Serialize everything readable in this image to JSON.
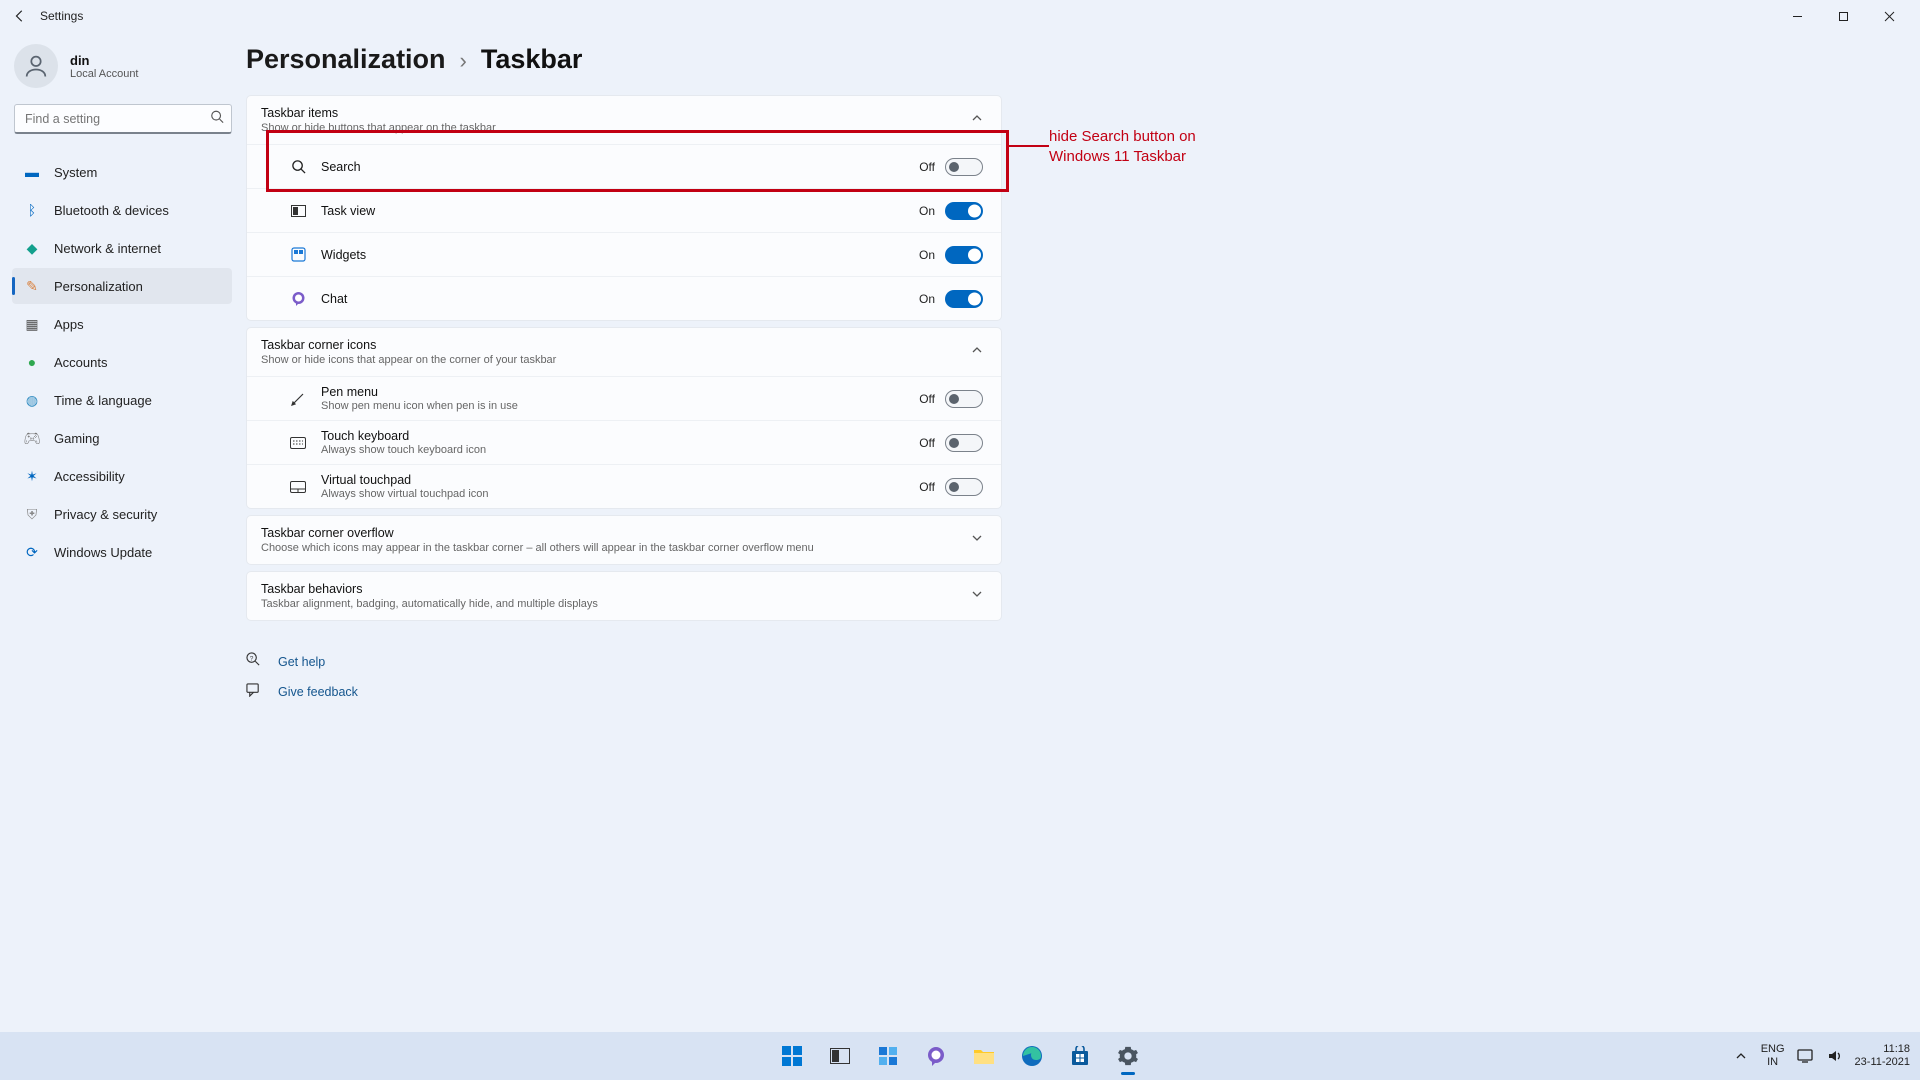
{
  "titlebar": {
    "title": "Settings"
  },
  "user": {
    "name": "din",
    "account": "Local Account"
  },
  "search": {
    "placeholder": "Find a setting"
  },
  "nav": {
    "system": "System",
    "bluetooth": "Bluetooth & devices",
    "network": "Network & internet",
    "personalization": "Personalization",
    "apps": "Apps",
    "accounts": "Accounts",
    "time": "Time & language",
    "gaming": "Gaming",
    "accessibility": "Accessibility",
    "privacy": "Privacy & security",
    "update": "Windows Update"
  },
  "crumb": {
    "parent": "Personalization",
    "sep": "›",
    "current": "Taskbar"
  },
  "panels": {
    "items": {
      "title": "Taskbar items",
      "sub": "Show or hide buttons that appear on the taskbar",
      "search": {
        "label": "Search",
        "state": "Off"
      },
      "taskview": {
        "label": "Task view",
        "state": "On"
      },
      "widgets": {
        "label": "Widgets",
        "state": "On"
      },
      "chat": {
        "label": "Chat",
        "state": "On"
      }
    },
    "corner": {
      "title": "Taskbar corner icons",
      "sub": "Show or hide icons that appear on the corner of your taskbar",
      "pen": {
        "label": "Pen menu",
        "sub": "Show pen menu icon when pen is in use",
        "state": "Off"
      },
      "touchkb": {
        "label": "Touch keyboard",
        "sub": "Always show touch keyboard icon",
        "state": "Off"
      },
      "touchpad": {
        "label": "Virtual touchpad",
        "sub": "Always show virtual touchpad icon",
        "state": "Off"
      }
    },
    "overflow": {
      "title": "Taskbar corner overflow",
      "sub": "Choose which icons may appear in the taskbar corner – all others will appear in the taskbar corner overflow menu"
    },
    "behaviors": {
      "title": "Taskbar behaviors",
      "sub": "Taskbar alignment, badging, automatically hide, and multiple displays"
    }
  },
  "links": {
    "help": "Get help",
    "feedback": "Give feedback"
  },
  "annotation": {
    "text1": "hide Search button on",
    "text2": "Windows 11 Taskbar"
  },
  "tray": {
    "lang1": "ENG",
    "lang2": "IN",
    "time": "11:18",
    "date": "23-11-2021"
  }
}
